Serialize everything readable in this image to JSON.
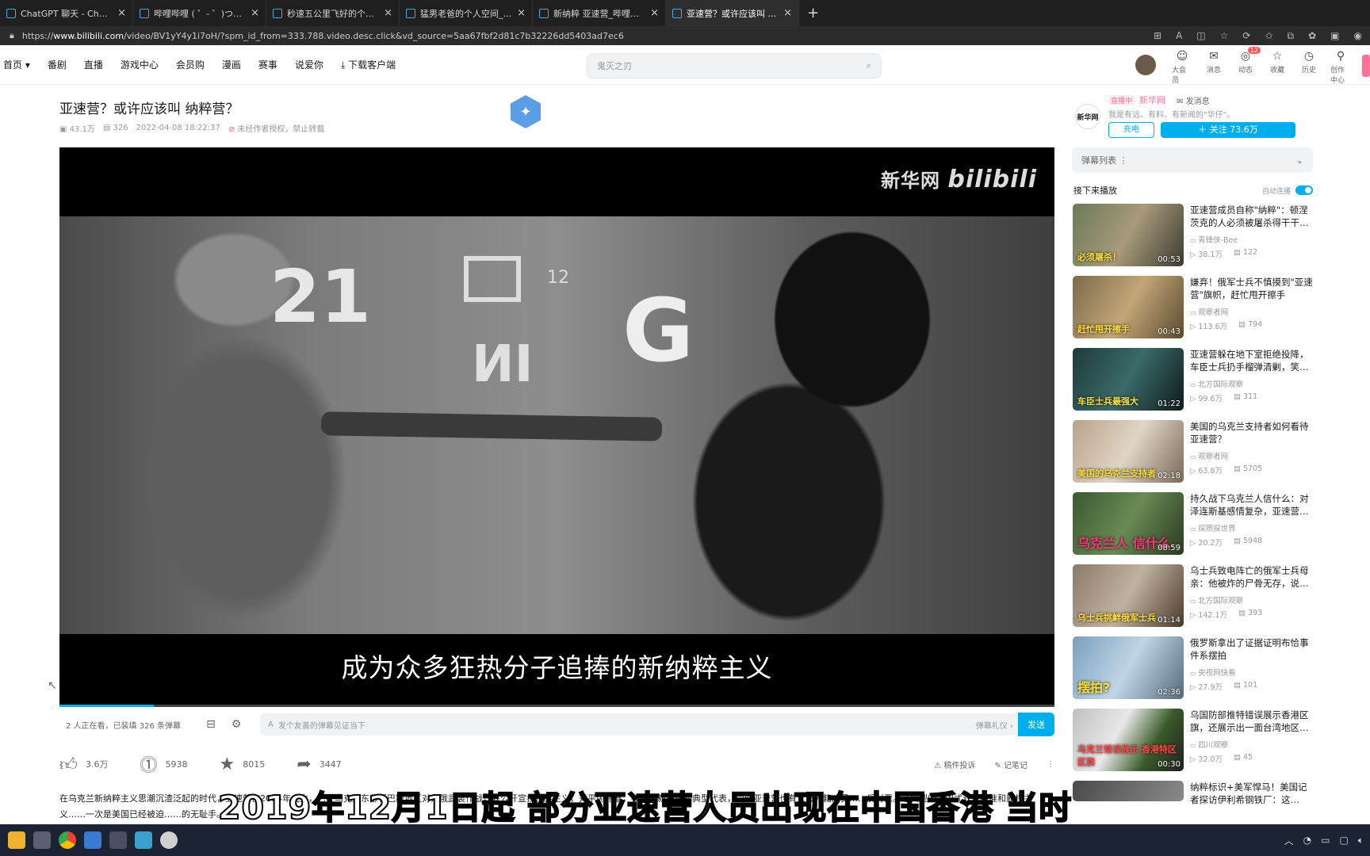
{
  "browser": {
    "tabs": [
      {
        "title": "ChatGPT 聊天 - ChatGPT v3.5"
      },
      {
        "title": "哔哩哔哩 ( ゜- ゜)つロ 干杯~-bili"
      },
      {
        "title": "秒速五公里飞好的个人空间_哔哩"
      },
      {
        "title": "猛男老爸的个人空间_哔哩哔哩_bi"
      },
      {
        "title": "新纳粹 亚速营_哔哩哔哩_bilibili"
      },
      {
        "title": "亚速营？或许应该叫 纳粹营？_哔"
      }
    ],
    "new_tab": "+",
    "url_prefix": "https://",
    "url_domain": "www.bilibili.com",
    "url_rest": "/video/BV1yY4y1i7oH/?spm_id_from=333.788.video.desc.click&vd_source=5aa67fbf2d81c7b32226dd5403ad7ec6"
  },
  "nav": {
    "items": [
      "首页 ▾",
      "番剧",
      "直播",
      "游戏中心",
      "会员购",
      "漫画",
      "赛事",
      "说爱你",
      "⤓ 下载客户端"
    ],
    "search_placeholder": "鬼灭之刃",
    "right_items": [
      {
        "label": "大会员",
        "icon": "☺"
      },
      {
        "label": "消息",
        "icon": "✉"
      },
      {
        "label": "动态",
        "icon": "◎",
        "badge": "12"
      },
      {
        "label": "收藏",
        "icon": "☆"
      },
      {
        "label": "历史",
        "icon": "◷"
      },
      {
        "label": "创作中心",
        "icon": "⚲"
      }
    ]
  },
  "video": {
    "title": "亚速营？或许应该叫 纳粹营？",
    "views": "▣ 43.1万",
    "danmaku_count": "▤ 326",
    "date": "2022-04-08 18:22:37",
    "notice": "未经作者授权，禁止转载",
    "watermark_cn": "新华网",
    "watermark_bili": "bilibili",
    "subtitle": "成为众多狂热分子追捧的新纳粹主义",
    "photo_text_1": "21",
    "photo_text_2": "G",
    "photo_text_3": "ИI",
    "photo_text_4": "12",
    "progress": 0.095
  },
  "danmaku_bar": {
    "count_text": "2 人正在看，已装填 326 条弹幕",
    "placeholder": "发个友善的弹幕见证当下",
    "etiquette": "弹幕礼仪 ›",
    "send": "发送"
  },
  "actions": {
    "like": "3.6万",
    "coin": "5938",
    "fav": "8015",
    "share": "3447",
    "report": "稿件投诉",
    "notes": "记笔记"
  },
  "description": "在乌克兰新纳粹主义思潮沉渣泛起的时代，亚速营在2014年成立，它在乌克兰东部顿巴斯地区对亲俄武装作战，并公开宣扬种族主义，对平民施暴，被视为新纳粹的典型代表，同时亚速营也有大量外籍成员……反对票。这典型的美国式双重标准和霸权主义……一次是美国已经被迫……的无耻手。",
  "overlay_subtitle": "2019年12月1日起 部分亚速营人员出现在中国香港 当时",
  "up": {
    "live_tag": "直播中",
    "name": "新华网",
    "message": "✉ 发消息",
    "sign": "我是有远、有料、有新闻的\"华仔\"。",
    "charge": "充电",
    "follow": "＋ 关注 73.6万",
    "avatar_text": "新华网"
  },
  "sidebar": {
    "danmaku_list": "弹幕列表",
    "next_label": "接下来播放",
    "autoplay_label": "自动连播"
  },
  "recs": [
    {
      "title": "亚速营成员自称\"纳粹\"：顿涅茨克的人必须被屠杀得干干…",
      "up": "青锋侠-Bee",
      "views": "38.1万",
      "danmaku": "122",
      "dur": "00:53",
      "cap": "必须屠杀！"
    },
    {
      "title": "嫌弃！俄军士兵不慎摸到\"亚速营\"旗帜，赶忙甩开擦手",
      "up": "观察者网",
      "views": "113.6万",
      "danmaku": "794",
      "dur": "00:43",
      "cap": "赶忙甩开擦手"
    },
    {
      "title": "亚速营躲在地下室拒绝投降，车臣士兵扔手榴弹清剿，笑…",
      "up": "北方国际观察",
      "views": "99.6万",
      "danmaku": "311",
      "dur": "01:22",
      "cap": "车臣士兵最强大"
    },
    {
      "title": "美国的乌克兰支持者如何看待亚速营？",
      "up": "观察者网",
      "views": "63.8万",
      "danmaku": "5705",
      "dur": "02:18",
      "cap": "美国的乌克兰支持者"
    },
    {
      "title": "持久战下乌克兰人信什么：对泽连斯基感情复杂，亚速营…",
      "up": "探照探世界",
      "views": "20.2万",
      "danmaku": "5948",
      "dur": "08:59",
      "cap": "乌克兰人 信什么"
    },
    {
      "title": "乌士兵致电阵亡的俄军士兵母亲：他被炸的尸骨无存，说…",
      "up": "北方国际观察",
      "views": "142.1万",
      "danmaku": "393",
      "dur": "01:14",
      "cap": "乌士兵挑衅俄军士兵"
    },
    {
      "title": "俄罗斯拿出了证据证明布恰事件系摆拍",
      "up": "央视网快看",
      "views": "27.9万",
      "danmaku": "101",
      "dur": "02:36",
      "cap": "摆拍?"
    },
    {
      "title": "乌国防部推特错误展示香港区旗，还展示出一面台湾地区…",
      "up": "四川观察",
      "views": "32.0万",
      "danmaku": "45",
      "dur": "00:30",
      "cap": "乌克兰错误展示 香港特区区旗"
    },
    {
      "title": "纳粹标识+美军悍马！美国记者探访伊利希钢铁厂：这…",
      "up": "",
      "views": "",
      "danmaku": "",
      "dur": "",
      "cap": ""
    }
  ],
  "colors": {
    "accent": "#00aeec",
    "pink": "#fb7299"
  }
}
